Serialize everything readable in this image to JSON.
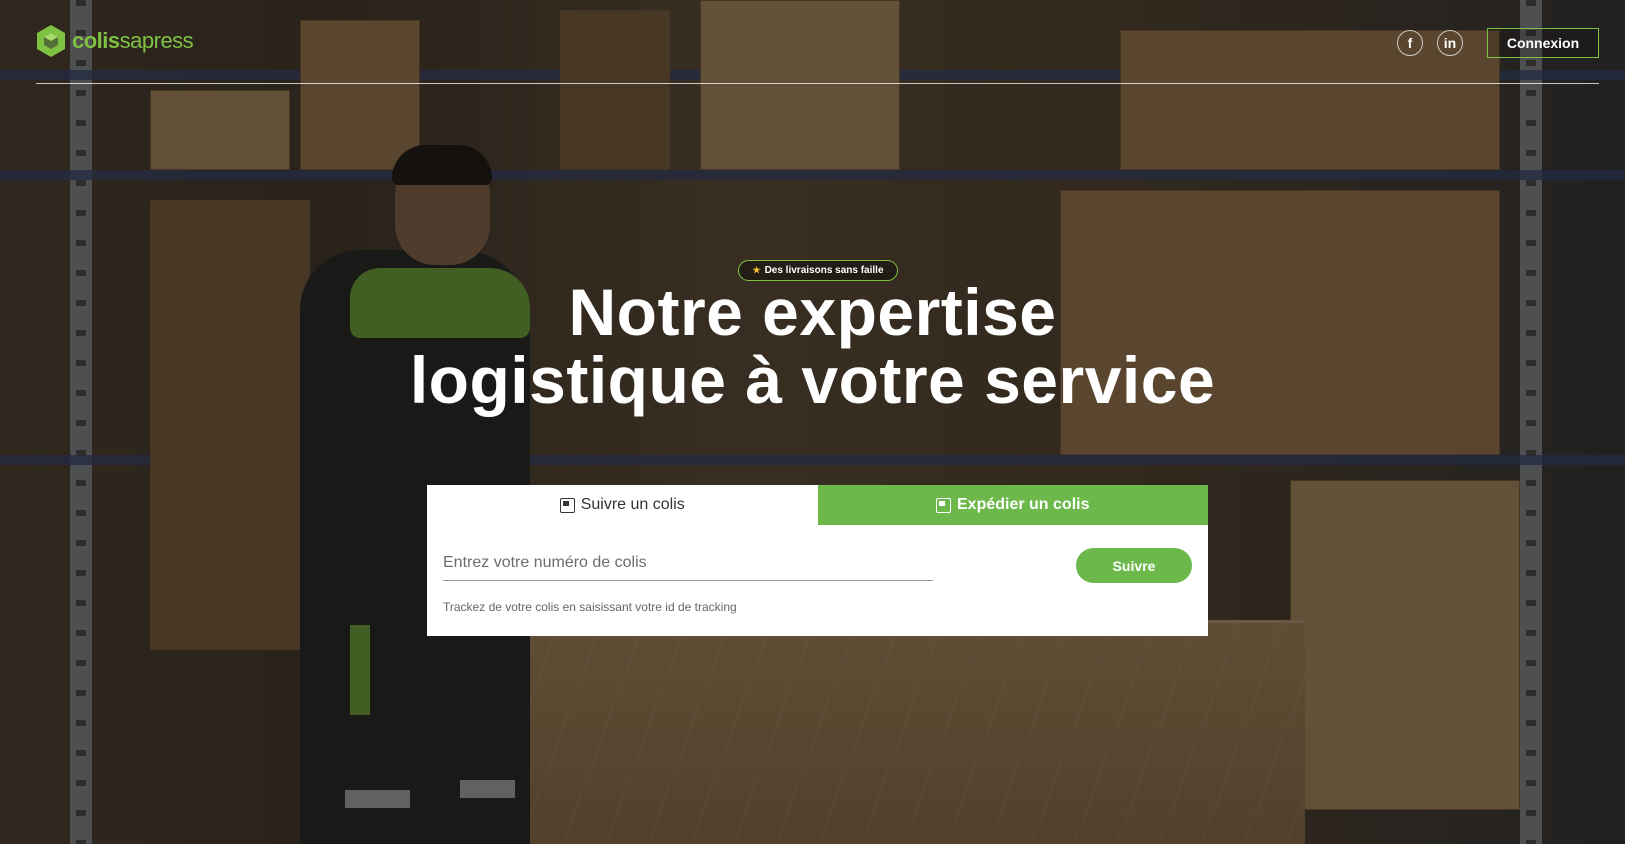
{
  "brand": {
    "name_part1": "colis",
    "name_part2": "sapress",
    "accent_color": "#7fc243",
    "logo_icon": "cube-icon"
  },
  "header": {
    "social": [
      {
        "name": "facebook",
        "glyph": "f"
      },
      {
        "name": "linkedin",
        "glyph": "in"
      }
    ],
    "login_label": "Connexion"
  },
  "hero": {
    "badge_icon": "star-icon",
    "badge_label": "Des livraisons sans faille",
    "title_line1": "Notre expertise",
    "title_line2": "logistique à votre service"
  },
  "tracking": {
    "tabs": [
      {
        "label": "Suivre un colis",
        "icon": "package-icon",
        "active": true
      },
      {
        "label": "Expédier un colis",
        "icon": "package-icon",
        "active": false
      }
    ],
    "input_placeholder": "Entrez votre numéro de colis",
    "input_value": "",
    "hint": "Trackez de votre colis en saisissant votre id de tracking",
    "submit_label": "Suivre",
    "tab_alt_color": "#6cb84a"
  }
}
